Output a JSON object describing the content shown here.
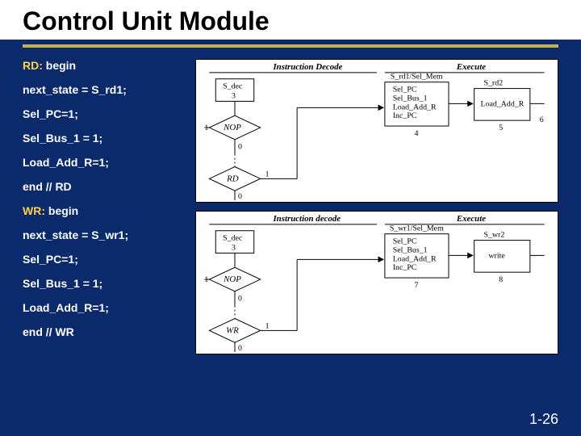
{
  "title": "Control Unit Module",
  "code": [
    {
      "kw": "RD:",
      "rest": " begin"
    },
    {
      "kw": "",
      "rest": "next_state = S_rd1;"
    },
    {
      "kw": "",
      "rest": "Sel_PC=1;"
    },
    {
      "kw": "",
      "rest": "Sel_Bus_1 = 1;"
    },
    {
      "kw": "",
      "rest": "Load_Add_R=1;"
    },
    {
      "kw": "",
      "rest": "end    //  RD"
    },
    {
      "kw": "WR:",
      "rest": " begin"
    },
    {
      "kw": "",
      "rest": "next_state = S_wr1;"
    },
    {
      "kw": "",
      "rest": "Sel_PC=1;"
    },
    {
      "kw": "",
      "rest": "Sel_Bus_1 = 1;"
    },
    {
      "kw": "",
      "rest": "Load_Add_R=1;"
    },
    {
      "kw": "",
      "rest": "end    //  WR"
    }
  ],
  "page_number": "1-26",
  "diagram_top": {
    "header_left": "Instruction Decode",
    "header_right": "Execute",
    "state": "S_dec",
    "state_num": "3",
    "nop": "NOP",
    "op": "RD",
    "one": "1",
    "zero": "0",
    "exec1": {
      "num": "4",
      "lines": [
        "Sel_PC",
        "Sel_Bus_1",
        "Load_Add_R",
        "Inc_PC"
      ],
      "label": "S_rd1/Sel_Mem"
    },
    "exec2": {
      "num": "5",
      "lines": [
        "Load_Add_R"
      ],
      "label": "S_rd2"
    },
    "exec3_num": "6"
  },
  "diagram_bottom": {
    "header_left": "Instruction decode",
    "header_right": "Execute",
    "state": "S_dec",
    "state_num": "3",
    "nop": "NOP",
    "op": "WR",
    "one": "1",
    "zero": "0",
    "exec1": {
      "num": "7",
      "lines": [
        "Sel_PC",
        "Sel_Bus_1",
        "Load_Add_R",
        "Inc_PC"
      ],
      "label": "S_wr1/Sel_Mem"
    },
    "exec2": {
      "num": "8",
      "lines": [
        "write"
      ],
      "label": "S_wr2"
    },
    "exec3_num": ""
  }
}
